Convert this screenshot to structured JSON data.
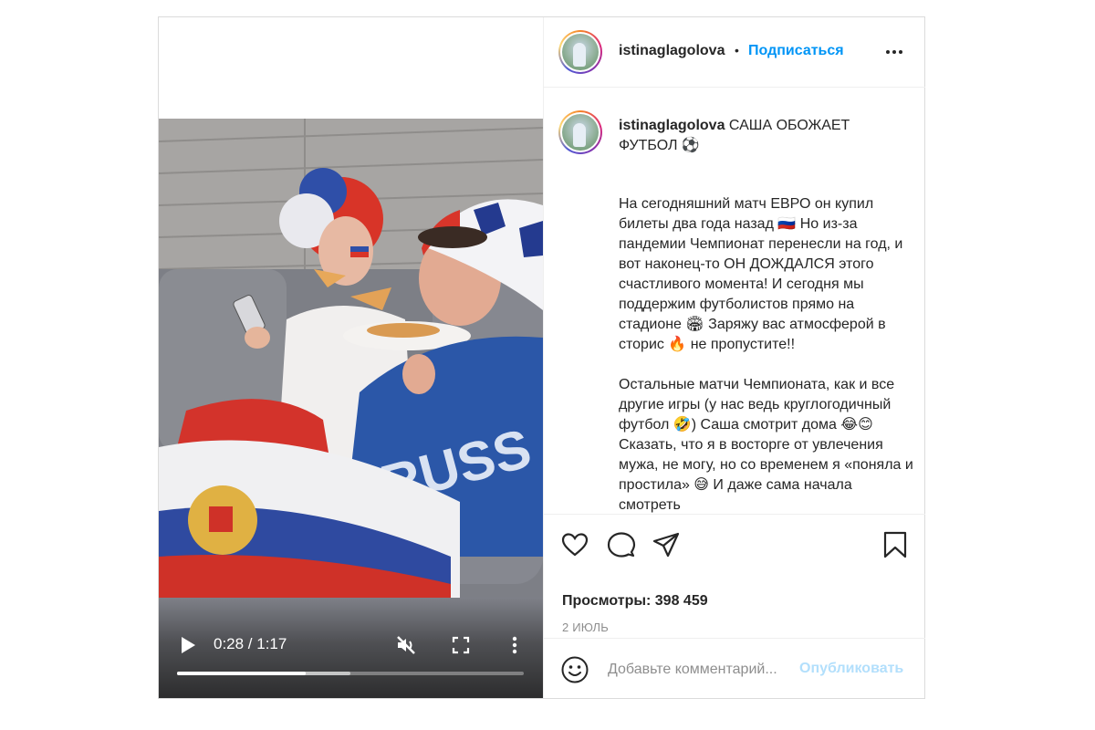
{
  "post": {
    "username": "istinaglagolova",
    "separator": "•",
    "follow_label": "Подписаться",
    "more_icon": "more-horizontal-icon",
    "caption_user": "istinaglagolova",
    "caption_headline": "САША ОБОЖАЕТ ФУТБОЛ ⚽",
    "caption_body": "На сегодняшний матч ЕВРО он купил билеты два года назад 🇷🇺 Но из-за пандемии Чемпионат перенесли на год, и вот наконец-то ОН ДОЖДАЛСЯ этого счастливого момента! И сегодня мы поддержим футболистов прямо на стадионе 🏟 Заряжу вас атмосферой в сторис 🔥 не пропустите!!\n\nОстальные матчи Чемпионата, как и все другие игры (у нас ведь круглогодичный футбол 🤣) Саша смотрит дома 😂😊 Сказать, что я в восторге от увлечения мужа, не могу, но со временем я «поняла и простила» 😅 И даже сама начала смотреть",
    "views_label": "Просмотры: 398 459",
    "date_label": "2 ИЮЛЬ"
  },
  "video": {
    "time_label": "0:28 / 1:17",
    "played_fraction": 0.37,
    "buffered_fraction": 0.5,
    "icons": [
      "play-icon",
      "mute-icon",
      "fullscreen-icon",
      "more-vertical-icon"
    ]
  },
  "actions": {
    "icons": [
      "heart-icon",
      "comment-icon",
      "share-icon",
      "bookmark-icon"
    ]
  },
  "comment": {
    "placeholder": "Добавьте комментарий...",
    "publish_label": "Опубликовать",
    "emoji_icon": "smiley-icon"
  },
  "colors": {
    "link": "#0095f6",
    "publish_disabled": "#b2dffc",
    "muted_text": "#8e8e8e",
    "border": "#dbdbdb"
  }
}
